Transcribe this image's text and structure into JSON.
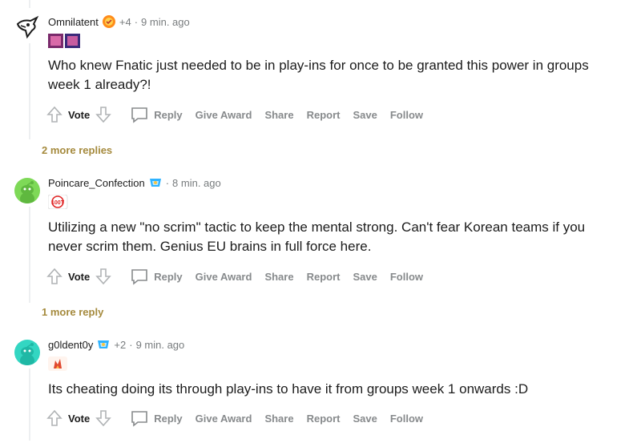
{
  "comments": [
    {
      "username": "Omnilatent",
      "award_count": "+4",
      "separator": "·",
      "timestamp": "9 min. ago",
      "body": "Who knew Fnatic just needed to be in play-ins for once to be granted this power in groups week 1 already?!",
      "vote_label": "Vote",
      "actions": [
        "Reply",
        "Give Award",
        "Share",
        "Report",
        "Save",
        "Follow"
      ],
      "more_replies": "2 more replies"
    },
    {
      "username": "Poincare_Confection",
      "separator": "·",
      "timestamp": "8 min. ago",
      "body": "Utilizing a new \"no scrim\" tactic to keep the mental strong. Can't fear Korean teams if you never scrim them. Genius EU brains in full force here.",
      "vote_label": "Vote",
      "actions": [
        "Reply",
        "Give Award",
        "Share",
        "Report",
        "Save",
        "Follow"
      ],
      "more_replies": "1 more reply",
      "flair_text": "100T"
    },
    {
      "username": "g0ldent0y",
      "award_count": "+2",
      "separator": "·",
      "timestamp": "9 min. ago",
      "body": "Its cheating doing its through play-ins to have it from groups week 1 onwards :D",
      "vote_label": "Vote",
      "actions": [
        "Reply",
        "Give Award",
        "Share",
        "Report",
        "Save",
        "Follow"
      ]
    }
  ],
  "colors": {
    "award_orange": "#ff8c1a",
    "award_teal": "#2fb3ff",
    "avatar_green": "#7ed957",
    "avatar_teal": "#33d6c2",
    "more_replies": "#a58a3d",
    "muted": "#878a8c"
  }
}
